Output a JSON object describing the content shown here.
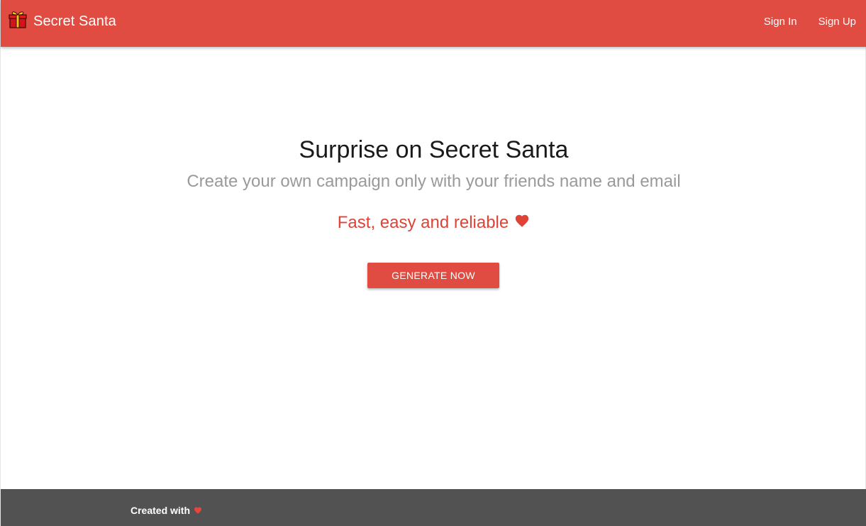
{
  "navbar": {
    "brand_icon": "gift-icon",
    "brand_label": "Secret Santa",
    "sign_in_label": "Sign In",
    "sign_up_label": "Sign Up",
    "background_color": "#e04c41"
  },
  "hero": {
    "title": "Surprise on Secret Santa",
    "subtitle": "Create your own campaign only with your friends name and email",
    "tagline": "Fast, easy and reliable",
    "tagline_icon": "heart-icon",
    "cta_label": "GENERATE NOW"
  },
  "footer": {
    "text": "Created with",
    "icon": "heart-icon",
    "background_color": "#525252"
  },
  "colors": {
    "accent": "#e04c41",
    "heading": "#1a1a1a",
    "muted": "#9a9a9a"
  }
}
